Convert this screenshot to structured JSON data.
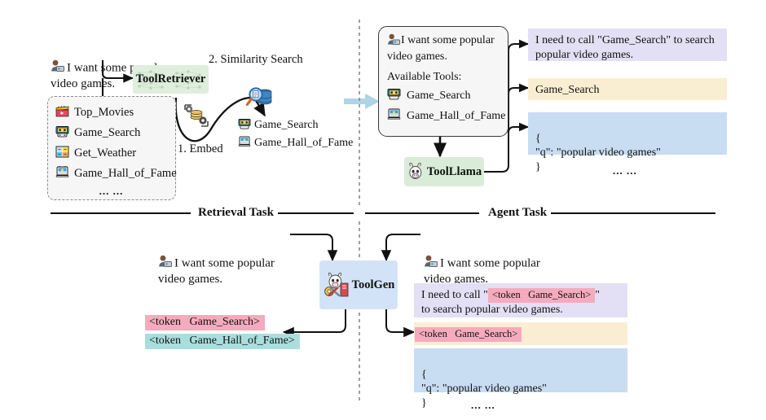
{
  "sections": {
    "retrieval_label": "Retrieval Task",
    "agent_label": "Agent Task"
  },
  "top_left": {
    "user_query": "I want some popular\nvideo games.",
    "retriever_label": "ToolRetriever",
    "step1": "1. Embed",
    "step2": "2. Similarity Search",
    "tool_list": [
      {
        "icon": "clapperboard-icon",
        "label": "Top_Movies"
      },
      {
        "icon": "game-controller-icon",
        "label": "Game_Search"
      },
      {
        "icon": "weather-icon",
        "label": "Get_Weather"
      },
      {
        "icon": "trophy-robot-icon",
        "label": "Game_Hall_of_Fame"
      }
    ],
    "tool_list_more": "... ...",
    "results": [
      {
        "icon": "game-controller-icon",
        "label": "Game_Search"
      },
      {
        "icon": "trophy-robot-icon",
        "label": "Game_Hall_of_Fame"
      }
    ]
  },
  "top_right": {
    "panel_query": "I want some popular\nvideo games.",
    "available_tools_label": "Available Tools:",
    "panel_tools": [
      {
        "icon": "game-controller-icon",
        "label": "Game_Search"
      },
      {
        "icon": "trophy-robot-icon",
        "label": "Game_Hall_of_Fame"
      }
    ],
    "model_label": "ToolLlama",
    "out_thought": "I need to call \"Game_Search\" to search popular video games.",
    "out_action": "Game_Search",
    "out_args": "{\n  \"q\": \"popular video games\"\n}",
    "more": "... ..."
  },
  "bottom_left": {
    "user_query": "I want some popular\nvideo games.",
    "model_label": "ToolGen",
    "tokens": [
      {
        "text": "<token   Game_Search>",
        "color": "#f5aabd"
      },
      {
        "text": "<token   Game_Hall_of_Fame>",
        "color": "#aadedd"
      }
    ]
  },
  "bottom_right": {
    "user_query": "I want some popular\nvideo games.",
    "thought_prefix": "I need to call  \"",
    "thought_token": "<token   Game_Search>",
    "thought_suffix": "\"",
    "thought_tail": "to search popular video games.",
    "action_token": "<token   Game_Search>",
    "out_args": "{\n  \"q\": \"popular video games\"\n}",
    "more": "... ..."
  },
  "colors": {
    "retriever_bg": "#dfeedd",
    "toolllama_bg": "#d9ecd7",
    "toolgen_bg": "#d3e3f7",
    "thought_bg": "#e3dff4",
    "action_bg": "#faeed2",
    "args_bg": "#c8dcf2",
    "token_pink": "#f5aabd",
    "token_teal": "#aadedd",
    "transition_arrow": "#aed4e6"
  }
}
